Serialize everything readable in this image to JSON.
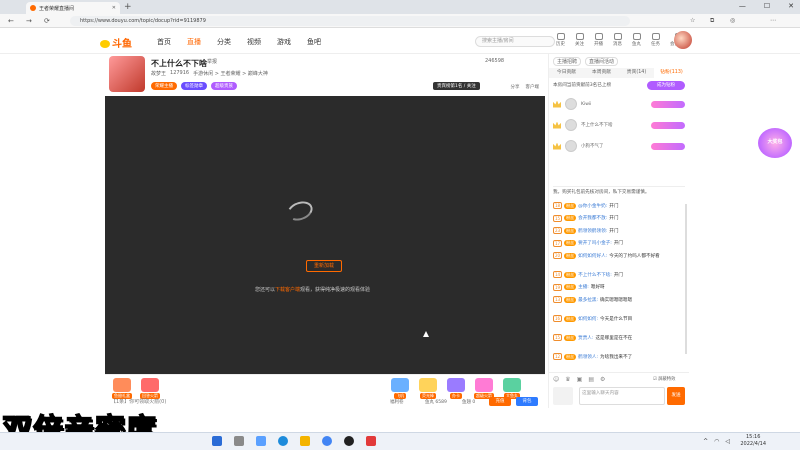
{
  "browser": {
    "tab_title": "王者荣耀直播间",
    "url": "https://www.douyu.com/topic/docup?rid=9119879",
    "new_tab": "+"
  },
  "site": {
    "logo": "斗鱼",
    "nav": [
      "首页",
      "直播",
      "分类",
      "视频",
      "游戏",
      "鱼吧"
    ],
    "nav_active_index": 1,
    "search_placeholder": "搜索主播/房间",
    "header_icons": [
      "历史",
      "关注",
      "开播",
      "消息",
      "鱼丸",
      "任务",
      "会员中心"
    ]
  },
  "room": {
    "title": "不上什么不下啥",
    "meta": [
      "举报",
      "手游休闲 > 王者荣耀 > 巅峰大神"
    ],
    "anchor": "故梦王",
    "heat": "127916",
    "rank_label": "贵宾榜第1名 / 关注",
    "report": "举报",
    "follow_count": "246598",
    "follow_label": "关注",
    "share": "分享",
    "client": "客户端",
    "tags": [
      "荣耀主播",
      "标签勋章",
      "超级贵族"
    ],
    "tag_colors": [
      "#ff6a00",
      "#6a4cff",
      "#b05cff"
    ]
  },
  "player": {
    "reload_label": "重新加载",
    "notice_pre": "您还可以",
    "notice_link": "下载客户端",
    "notice_post": "观看，获得纯净极速的观看体验"
  },
  "giftbar": {
    "gifts": [
      "鱼翅礼盒",
      "回答火箭",
      "飞机",
      "荧光棒",
      "办卡",
      "超级火箭",
      "大鱼丸"
    ],
    "input_placeholder": "【1条】你可领取火箭(0)",
    "count1": "福利卷",
    "count2": "鱼丸 6589",
    "count3": "鱼翅 0",
    "send1": "充值",
    "send2": "背包"
  },
  "right_panel": {
    "top_links": [
      "主播招聘",
      "直播间活动"
    ],
    "tabs": [
      "今日贡献",
      "本周贡献",
      "贵宾(14)",
      "钻粉(113)"
    ],
    "notice": "本房间当前贡献前3名已上榜",
    "buy_label": "成为钻粉",
    "ranks": [
      {
        "name": "Kiwii"
      },
      {
        "name": "不上什么不下啥"
      },
      {
        "name": "小狗不气了"
      }
    ],
    "system_msg": "我，购买礼包前先核对房间，私下交易需谨慎。",
    "chat": [
      {
        "lv": "18",
        "fan": "粉丝",
        "user": "@你小金牛奶:",
        "msg": "开门"
      },
      {
        "lv": "15",
        "fan": "粉丝",
        "user": "会开我都不放:",
        "msg": "开门"
      },
      {
        "lv": "23",
        "fan": "粉丝",
        "user": "鹤领领鹤领领:",
        "msg": "开门"
      },
      {
        "lv": "17",
        "fan": "粉丝",
        "user": "要开了吗小金子:",
        "msg": "开门"
      },
      {
        "lv": "20",
        "fan": "粉丝",
        "user": "如何如何好人:",
        "msg": "今天的了约吗人都不好看"
      },
      {
        "lv": "14",
        "fan": "粉丝",
        "user": "不上什么不下啥:",
        "msg": "开门"
      },
      {
        "lv": "19",
        "fan": "粉丝",
        "user": "主播:",
        "msg": "嗯好呀"
      },
      {
        "lv": "13",
        "fan": "粉丝",
        "user": "最多拉黑:",
        "msg": "确实嗯嗯嗯嗯嗯"
      },
      {
        "lv": "16",
        "fan": "粉丝",
        "user": "如何如何:",
        "msg": "今天是什么节目"
      },
      {
        "lv": "15",
        "fan": "粉丝",
        "user": "贾贾人:",
        "msg": "这是哪里是在不在"
      },
      {
        "lv": "12",
        "fan": "粉丝",
        "user": "鹤领领人:",
        "msg": "为啥我出来不了"
      }
    ],
    "input_placeholder": "这里输入聊天内容",
    "send_label": "发送",
    "check_label": "屏蔽特效"
  },
  "side_badge": "大奖包",
  "caption": "双倍亲密度",
  "taskbar": {
    "time": "15:16",
    "date": "2022/4/14"
  }
}
